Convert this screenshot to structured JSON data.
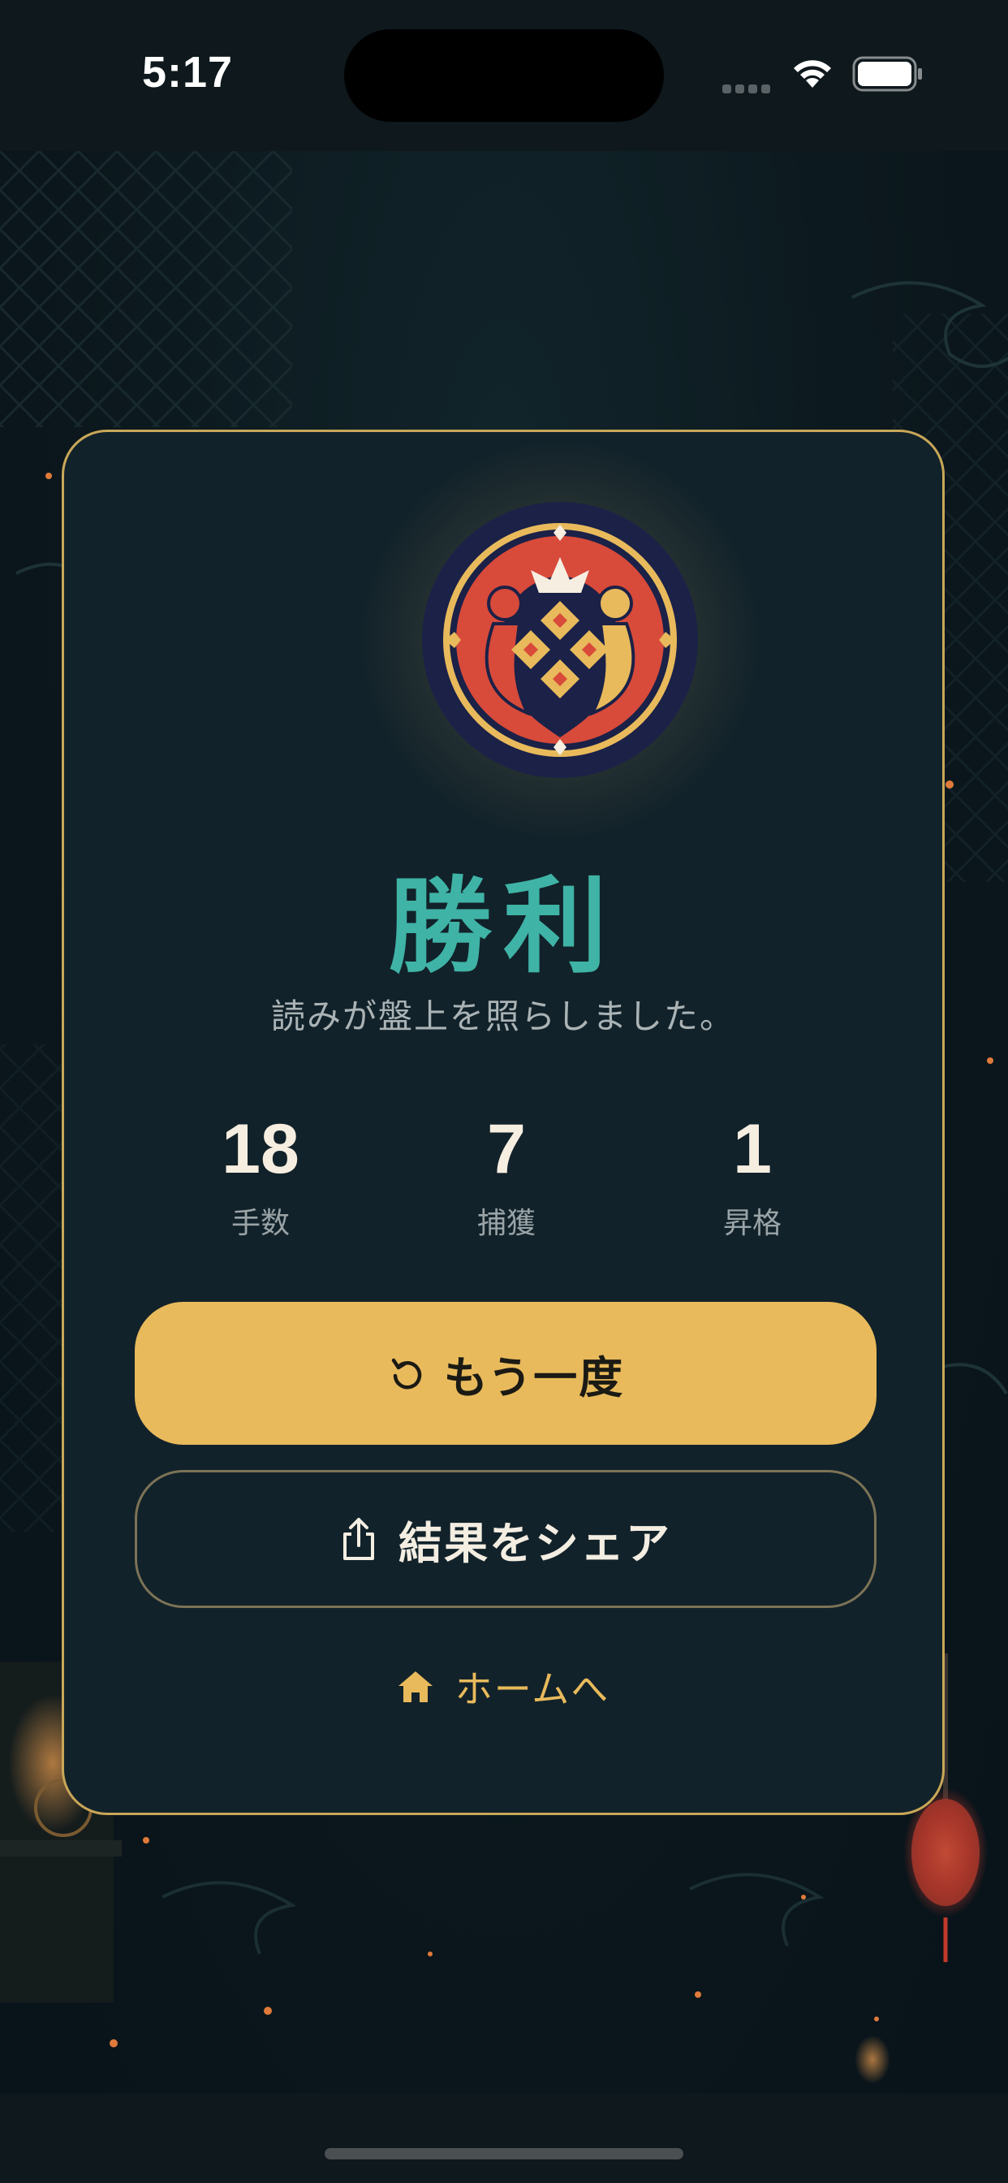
{
  "status_bar": {
    "time": "5:17",
    "icons": [
      "cellular-signal-icon",
      "wifi-icon",
      "battery-icon"
    ]
  },
  "result_card": {
    "emblem": "shogi-crest-emblem",
    "title": "勝利",
    "subtitle": "読みが盤上を照らしました。",
    "stats": [
      {
        "value": "18",
        "label": "手数"
      },
      {
        "value": "7",
        "label": "捕獲"
      },
      {
        "value": "1",
        "label": "昇格"
      }
    ],
    "buttons": {
      "retry_label": "もう一度",
      "retry_icon": "refresh-icon",
      "share_label": "結果をシェア",
      "share_icon": "share-icon",
      "home_label": "ホームへ",
      "home_icon": "home-icon"
    }
  },
  "colors": {
    "accent_gold": "#e8ba5c",
    "title_teal": "#3fb3a6",
    "card_bg": "#12222a",
    "border_gold": "#c9a758"
  }
}
